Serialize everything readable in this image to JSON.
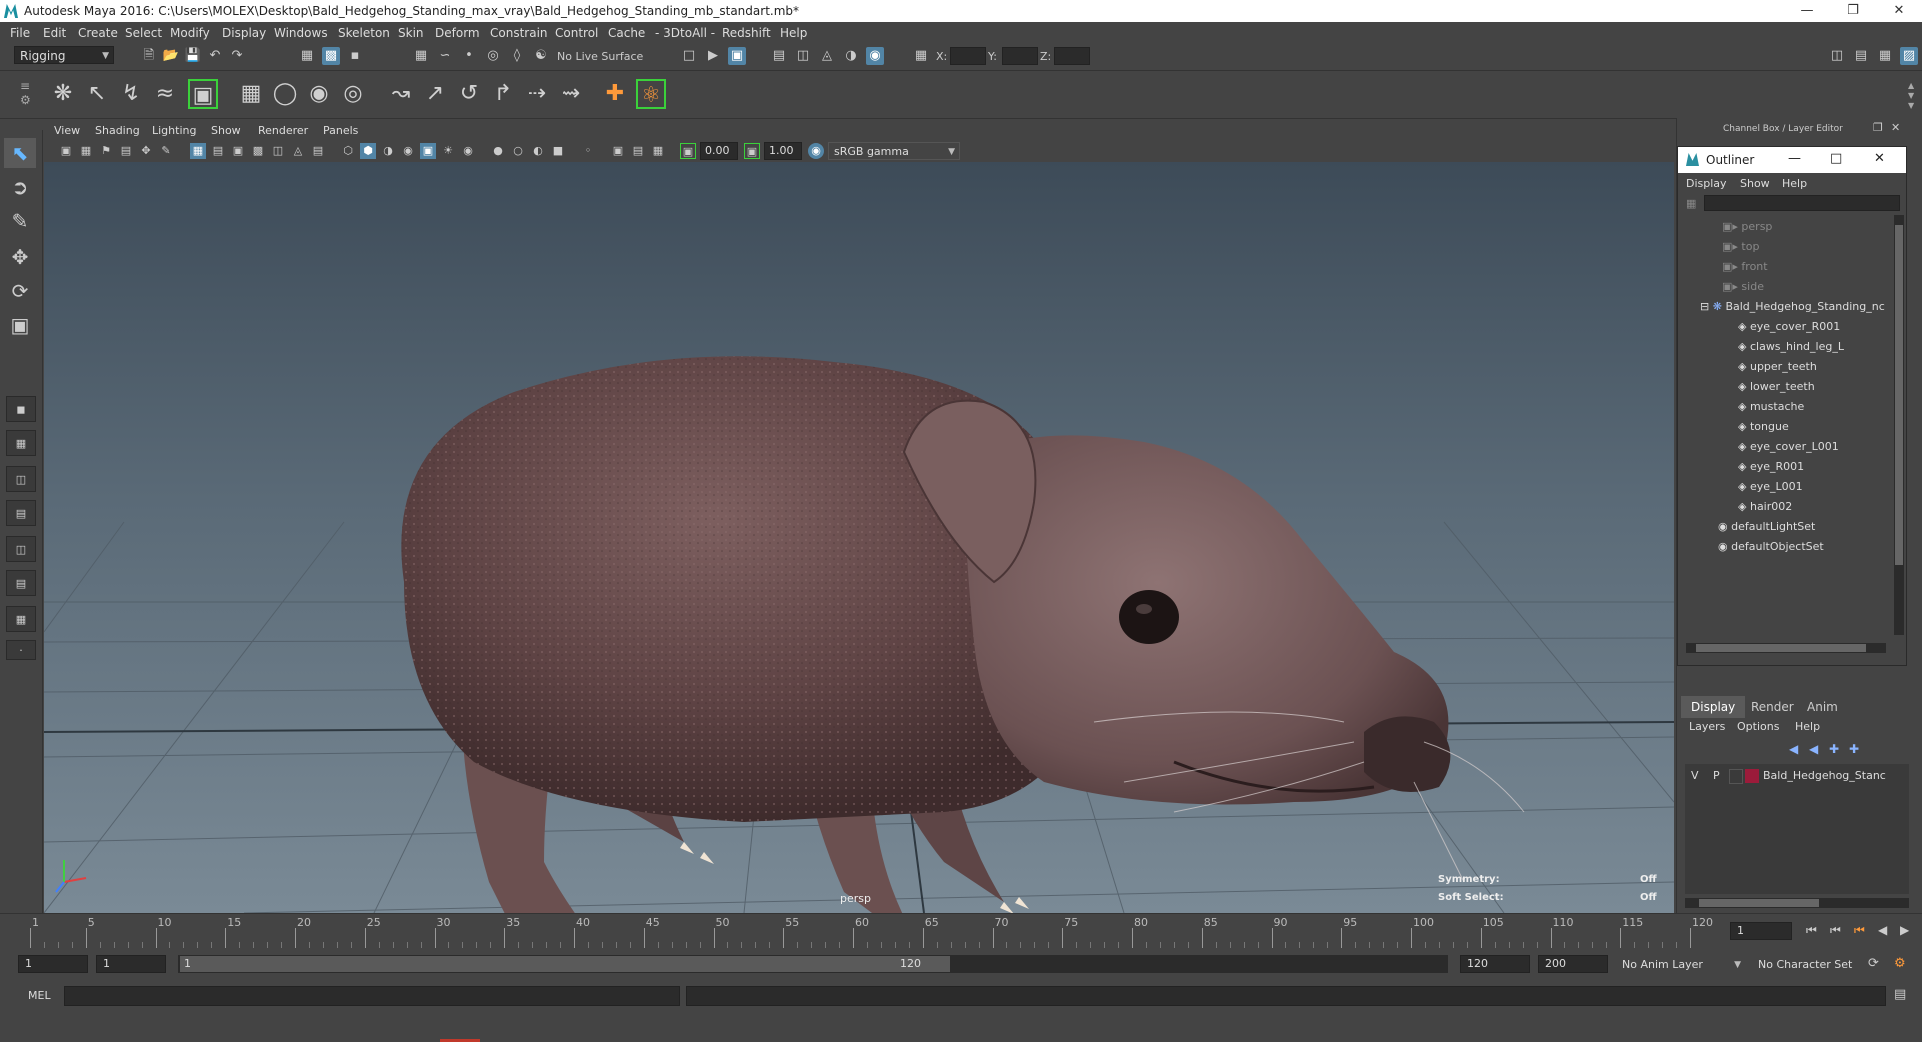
{
  "window": {
    "title": "Autodesk Maya 2016: C:\\Users\\MOLEX\\Desktop\\Bald_Hedgehog_Standing_max_vray\\Bald_Hedgehog_Standing_mb_standart.mb*"
  },
  "menubar": [
    "File",
    "Edit",
    "Create",
    "Select",
    "Modify",
    "Display",
    "Windows",
    "Skeleton",
    "Skin",
    "Deform",
    "Constrain",
    "Control",
    "Cache",
    "- 3DtoAll -",
    "Redshift",
    "Help"
  ],
  "status": {
    "menuset": "Rigging",
    "live_surface": "No Live Surface",
    "x_label": "X:",
    "y_label": "Y:",
    "z_label": "Z:"
  },
  "panel": {
    "menus": [
      "View",
      "Shading",
      "Lighting",
      "Show",
      "Renderer",
      "Panels"
    ],
    "exposure": "0.00",
    "gamma": "1.00",
    "colorspace": "sRGB gamma"
  },
  "viewport": {
    "camera": "persp",
    "symmetry_label": "Symmetry:",
    "symmetry_value": "Off",
    "soft_select_label": "Soft Select:",
    "soft_select_value": "Off"
  },
  "channel_box": {
    "title": "Channel Box / Layer Editor"
  },
  "outliner": {
    "title": "Outliner",
    "menus": [
      "Display",
      "Show",
      "Help"
    ],
    "items": [
      {
        "label": "persp",
        "dim": true
      },
      {
        "label": "top",
        "dim": true
      },
      {
        "label": "front",
        "dim": true
      },
      {
        "label": "side",
        "dim": true
      },
      {
        "label": "Bald_Hedgehog_Standing_nc",
        "dim": false
      },
      {
        "label": "eye_cover_R001",
        "dim": false
      },
      {
        "label": "claws_hind_leg_L",
        "dim": false
      },
      {
        "label": "upper_teeth",
        "dim": false
      },
      {
        "label": "lower_teeth",
        "dim": false
      },
      {
        "label": "mustache",
        "dim": false
      },
      {
        "label": "tongue",
        "dim": false
      },
      {
        "label": "eye_cover_L001",
        "dim": false
      },
      {
        "label": "eye_R001",
        "dim": false
      },
      {
        "label": "eye_L001",
        "dim": false
      },
      {
        "label": "hair002",
        "dim": false
      },
      {
        "label": "defaultLightSet",
        "dim": false
      },
      {
        "label": "defaultObjectSet",
        "dim": false
      }
    ]
  },
  "layer_editor": {
    "tabs": [
      "Display",
      "Render",
      "Anim"
    ],
    "menus": [
      "Layers",
      "Options",
      "Help"
    ],
    "layer": {
      "v": "V",
      "p": "P",
      "name": "Bald_Hedgehog_Stanc",
      "color": "#9b1b3a"
    }
  },
  "timeline": {
    "ticks": [
      "1",
      "5",
      "10",
      "15",
      "20",
      "25",
      "30",
      "35",
      "40",
      "45",
      "50",
      "55",
      "60",
      "65",
      "70",
      "75",
      "80",
      "85",
      "90",
      "95",
      "100",
      "105",
      "110",
      "115",
      "120"
    ],
    "current_frame": "1"
  },
  "range": {
    "start": "1",
    "playback_start": "1",
    "slider_start": "1",
    "slider_end": "120",
    "playback_end": "120",
    "end": "200",
    "anim_layer": "No Anim Layer",
    "character_set": "No Character Set"
  },
  "cmdline": {
    "label": "MEL"
  }
}
